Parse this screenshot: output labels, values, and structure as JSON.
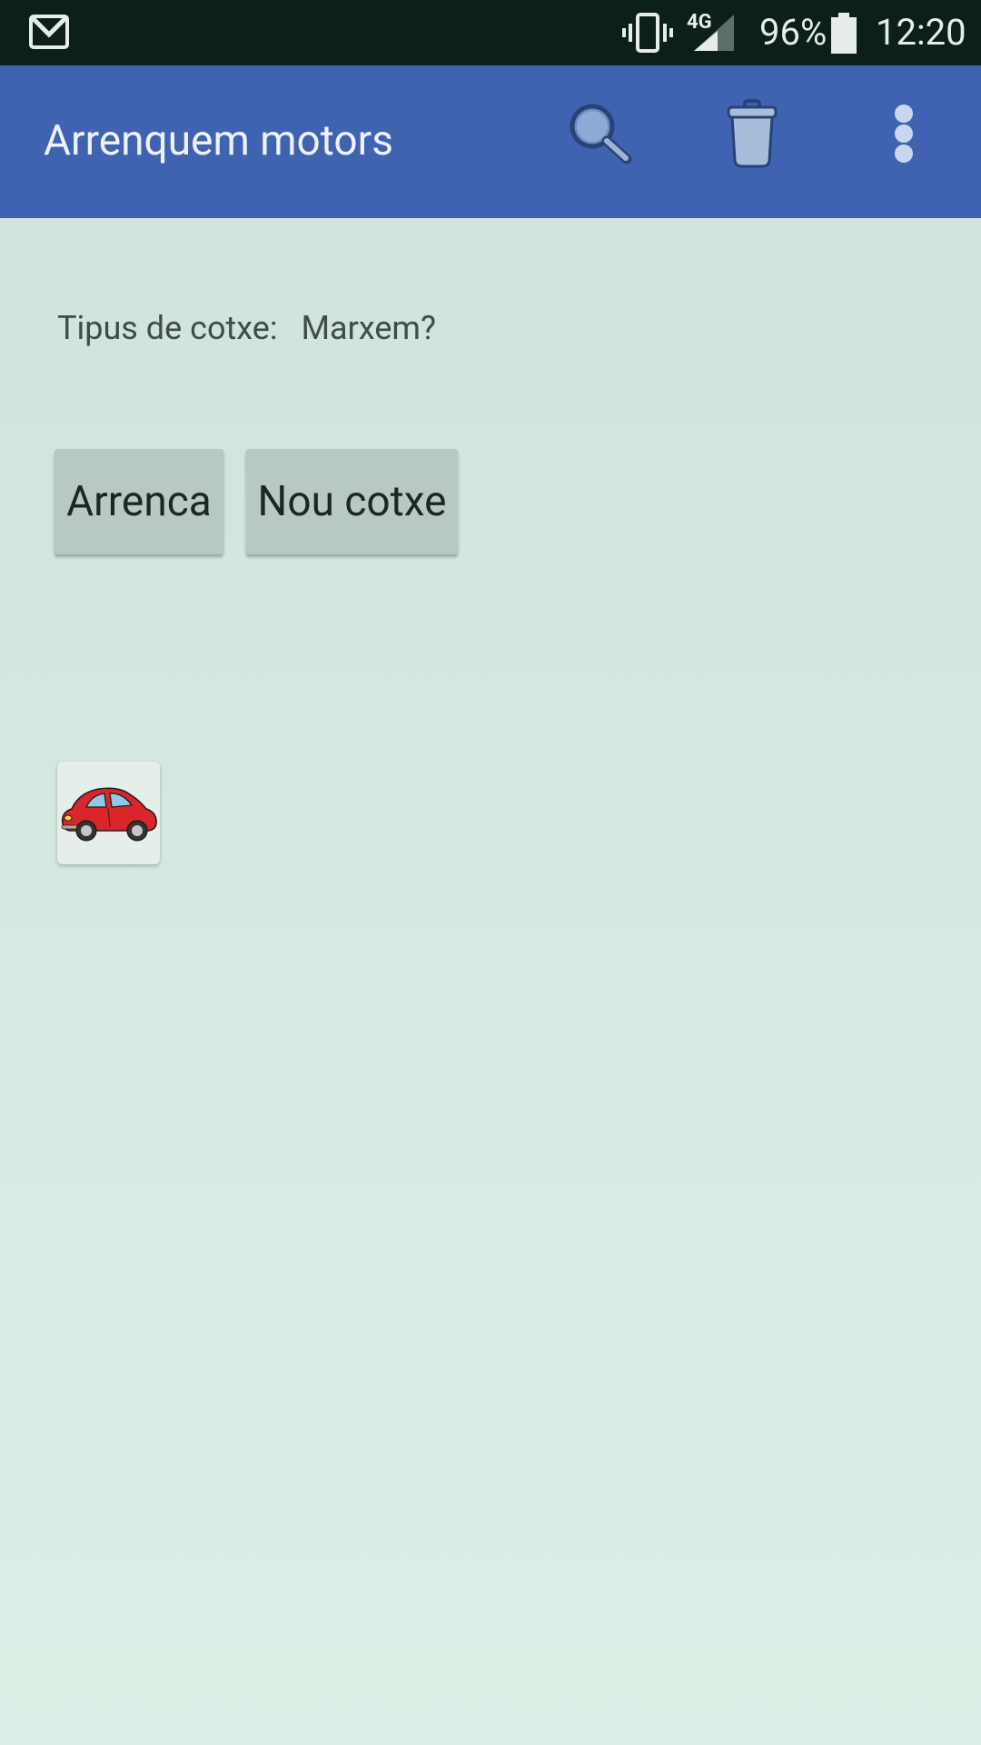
{
  "status_bar": {
    "network": "4G",
    "battery": "96%",
    "time": "12:20",
    "icons": [
      "gmail-icon",
      "vibrate-icon",
      "signal-icon",
      "battery-icon"
    ]
  },
  "app_bar": {
    "title": "Arrenquem motors",
    "color": "#4063b1",
    "actions": [
      "search-icon",
      "trash-icon",
      "more-vert-icon"
    ]
  },
  "content": {
    "type_label": "Tipus de cotxe:",
    "type_value": "Marxem?",
    "start_button": "Arrenca",
    "new_car_button": "Nou cotxe",
    "car_image": "red-car-icon"
  }
}
